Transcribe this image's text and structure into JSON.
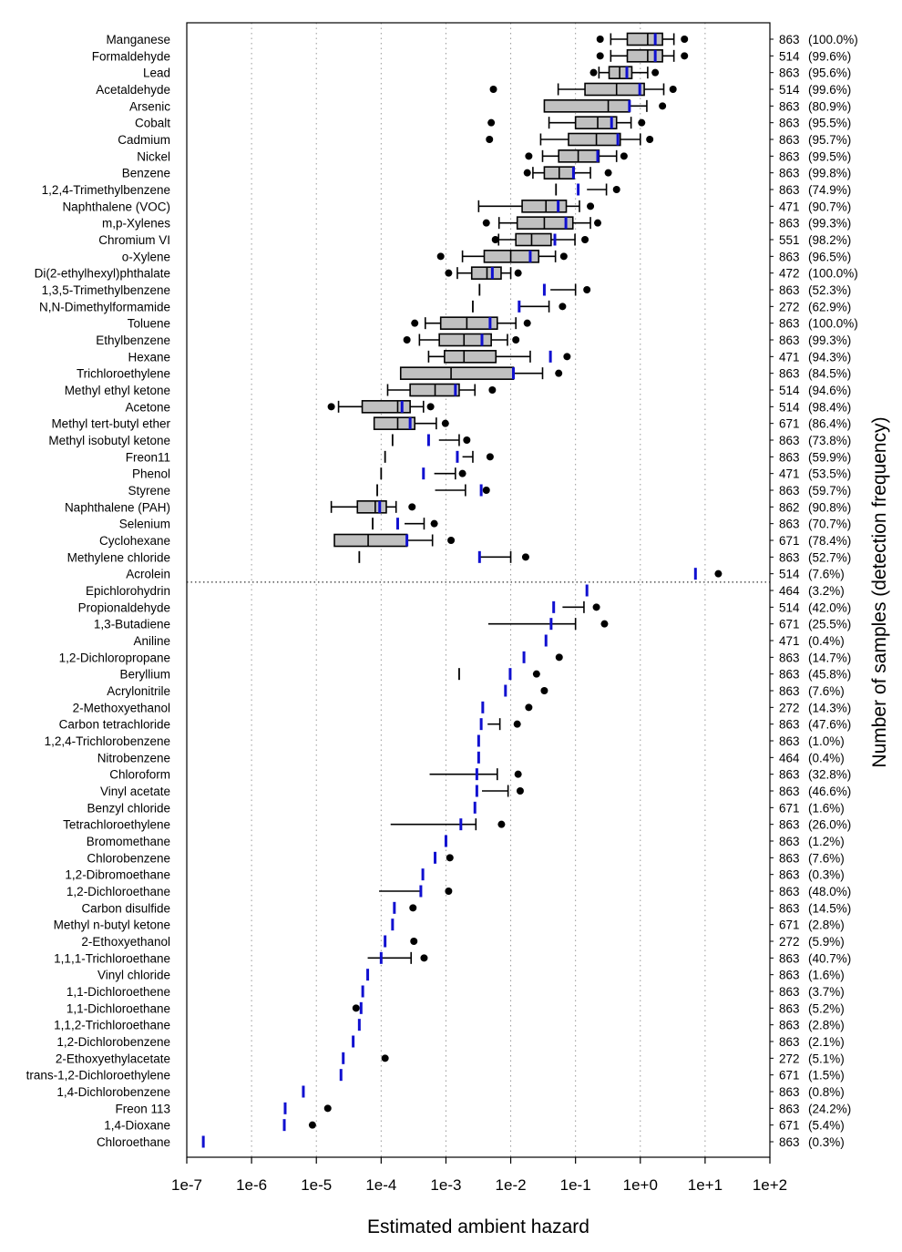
{
  "chart_data": {
    "type": "box",
    "xscale": "log",
    "xlim": [
      1e-07,
      100
    ],
    "xlabel": "Estimated ambient hazard",
    "ylabel_right": "Number of samples  (detection frequency)",
    "xticks": [
      "1e-7",
      "1e-6",
      "1e-5",
      "1e-4",
      "1e-3",
      "1e-2",
      "1e-1",
      "1e+0",
      "1e+1",
      "1e+2"
    ],
    "grid": "vertical dotted",
    "separator_after": "Acrolein",
    "colors": {
      "box": "#c0c0c0",
      "mean": "#1010d0",
      "outlier": "#000000",
      "grid": "#999999"
    },
    "rows": [
      {
        "name": "Manganese",
        "n": "863",
        "freq": "(100.0%)",
        "box": [
          0.35,
          0.63,
          1.3,
          2.2,
          3.3
        ],
        "mean": 1.7,
        "outliers": [
          0.24,
          4.8
        ]
      },
      {
        "name": "Formaldehyde",
        "n": "514",
        "freq": "(99.6%)",
        "box": [
          0.35,
          0.63,
          1.3,
          2.2,
          3.3
        ],
        "mean": 1.7,
        "outliers": [
          0.24,
          4.8
        ]
      },
      {
        "name": "Lead",
        "n": "863",
        "freq": "(95.6%)",
        "box": [
          0.23,
          0.33,
          0.48,
          0.74,
          1.3
        ],
        "mean": 0.62,
        "outliers": [
          0.19,
          1.7
        ]
      },
      {
        "name": "Acetaldehyde",
        "n": "514",
        "freq": "(99.6%)",
        "box": [
          0.054,
          0.14,
          0.43,
          1.15,
          2.3
        ],
        "mean": 0.98,
        "outliers": [
          0.0054,
          3.2
        ]
      },
      {
        "name": "Arsenic",
        "n": "863",
        "freq": "(80.9%)",
        "box": [
          0.033,
          0.033,
          0.32,
          0.68,
          1.26
        ],
        "mean": 0.68,
        "outliers": [
          2.2
        ]
      },
      {
        "name": "Cobalt",
        "n": "863",
        "freq": "(95.5%)",
        "box": [
          0.039,
          0.1,
          0.22,
          0.43,
          0.72
        ],
        "mean": 0.36,
        "outliers": [
          0.005,
          1.05
        ]
      },
      {
        "name": "Cadmium",
        "n": "863",
        "freq": "(95.7%)",
        "box": [
          0.029,
          0.078,
          0.21,
          0.49,
          1.0
        ],
        "mean": 0.45,
        "outliers": [
          0.0047,
          1.4
        ]
      },
      {
        "name": "Nickel",
        "n": "863",
        "freq": "(99.5%)",
        "box": [
          0.031,
          0.055,
          0.11,
          0.23,
          0.43
        ],
        "mean": 0.22,
        "outliers": [
          0.019,
          0.56
        ]
      },
      {
        "name": "Benzene",
        "n": "863",
        "freq": "(99.8%)",
        "box": [
          0.022,
          0.033,
          0.056,
          0.095,
          0.17
        ],
        "mean": 0.093,
        "outliers": [
          0.018,
          0.32
        ]
      },
      {
        "name": "1,2,4-Trimethylbenzene",
        "n": "863",
        "freq": "(74.9%)",
        "tick": 0.05,
        "mean": 0.11,
        "whisker": [
          0.15,
          0.3
        ],
        "outliers": [
          0.43
        ]
      },
      {
        "name": "Naphthalene (VOC)",
        "n": "471",
        "freq": "(90.7%)",
        "box": [
          0.0032,
          0.015,
          0.035,
          0.072,
          0.115
        ],
        "mean": 0.054,
        "outliers": [
          0.17
        ]
      },
      {
        "name": "m,p-Xylenes",
        "n": "863",
        "freq": "(99.3%)",
        "box": [
          0.0066,
          0.0126,
          0.033,
          0.091,
          0.17
        ],
        "mean": 0.071,
        "outliers": [
          0.0042,
          0.22
        ]
      },
      {
        "name": "Chromium VI",
        "n": "551",
        "freq": "(98.2%)",
        "box": [
          0.0065,
          0.012,
          0.021,
          0.042,
          0.098
        ],
        "mean": 0.048,
        "outliers": [
          0.0058,
          0.14
        ]
      },
      {
        "name": "o-Xylene",
        "n": "863",
        "freq": "(96.5%)",
        "box": [
          0.0018,
          0.0039,
          0.01,
          0.027,
          0.049
        ],
        "mean": 0.02,
        "outliers": [
          0.00083,
          0.066
        ]
      },
      {
        "name": "Di(2-ethylhexyl)phthalate",
        "n": "472",
        "freq": "(100.0%)",
        "box": [
          0.0015,
          0.0025,
          0.0043,
          0.0071,
          0.01
        ],
        "mean": 0.0052,
        "outliers": [
          0.0011,
          0.013
        ]
      },
      {
        "name": "1,3,5-Trimethylbenzene",
        "n": "863",
        "freq": "(52.3%)",
        "tick": 0.0033,
        "mean": 0.033,
        "whisker": [
          0.041,
          0.1
        ],
        "outliers": [
          0.15
        ]
      },
      {
        "name": "N,N-Dimethylformamide",
        "n": "272",
        "freq": "(62.9%)",
        "tick": 0.0026,
        "mean": 0.0135,
        "whisker": [
          0.0135,
          0.039
        ],
        "outliers": [
          0.063
        ]
      },
      {
        "name": "Toluene",
        "n": "863",
        "freq": "(100.0%)",
        "box": [
          0.00048,
          0.00083,
          0.0021,
          0.0062,
          0.012
        ],
        "mean": 0.0048,
        "outliers": [
          0.00033,
          0.018
        ]
      },
      {
        "name": "Ethylbenzene",
        "n": "863",
        "freq": "(99.3%)",
        "box": [
          0.00039,
          0.00079,
          0.0019,
          0.005,
          0.0089
        ],
        "mean": 0.0036,
        "outliers": [
          0.00025,
          0.012
        ]
      },
      {
        "name": "Hexane",
        "n": "471",
        "freq": "(94.3%)",
        "box": [
          0.00054,
          0.00095,
          0.0019,
          0.0059,
          0.02
        ],
        "mean": 0.041,
        "outliers": [
          0.074
        ]
      },
      {
        "name": "Trichloroethylene",
        "n": "863",
        "freq": "(84.5%)",
        "box": [
          0.0002,
          0.0002,
          0.0012,
          0.011,
          0.031
        ],
        "mean": 0.011,
        "outliers": [
          0.055
        ]
      },
      {
        "name": "Methyl ethyl ketone",
        "n": "514",
        "freq": "(94.6%)",
        "box": [
          0.000126,
          0.00028,
          0.00068,
          0.0016,
          0.0028
        ],
        "mean": 0.0014,
        "outliers": [
          0.0052
        ]
      },
      {
        "name": "Acetone",
        "n": "514",
        "freq": "(98.4%)",
        "box": [
          2.2e-05,
          5.1e-05,
          0.00018,
          0.00028,
          0.00045
        ],
        "mean": 0.00021,
        "outliers": [
          1.7e-05,
          0.00058
        ]
      },
      {
        "name": "Methyl tert-butyl ether",
        "n": "671",
        "freq": "(86.4%)",
        "box": [
          7.8e-05,
          7.8e-05,
          0.00018,
          0.00033,
          0.00071
        ],
        "mean": 0.00028,
        "outliers": [
          0.00098
        ]
      },
      {
        "name": "Methyl isobutyl ketone",
        "n": "863",
        "freq": "(73.8%)",
        "tick": 0.00015,
        "mean": 0.00054,
        "whisker": [
          0.00078,
          0.0016
        ],
        "outliers": [
          0.0021
        ]
      },
      {
        "name": "Freon11",
        "n": "863",
        "freq": "(59.9%)",
        "tick": 0.000115,
        "mean": 0.0015,
        "whisker": [
          0.0018,
          0.0026
        ],
        "outliers": [
          0.0048
        ]
      },
      {
        "name": "Phenol",
        "n": "471",
        "freq": "(53.5%)",
        "tick": 0.0001,
        "mean": 0.00045,
        "whisker": [
          0.00066,
          0.0014
        ],
        "outliers": [
          0.0018
        ]
      },
      {
        "name": "Styrene",
        "n": "863",
        "freq": "(59.7%)",
        "tick": 8.7e-05,
        "mean": 0.0035,
        "whisker": [
          0.00068,
          0.002
        ],
        "outliers": [
          0.0042
        ]
      },
      {
        "name": "Naphthalene (PAH)",
        "n": "862",
        "freq": "(90.8%)",
        "box": [
          1.7e-05,
          4.3e-05,
          8.1e-05,
          0.00012,
          0.00017
        ],
        "mean": 9.5e-05,
        "outliers": [
          0.0003
        ]
      },
      {
        "name": "Selenium",
        "n": "863",
        "freq": "(70.7%)",
        "tick": 7.4e-05,
        "mean": 0.00018,
        "whisker": [
          0.00023,
          0.00046
        ],
        "outliers": [
          0.00066
        ]
      },
      {
        "name": "Cyclohexane",
        "n": "671",
        "freq": "(78.4%)",
        "box": [
          1.9e-05,
          1.9e-05,
          6.3e-05,
          0.00025,
          0.00062
        ],
        "mean": 0.00025,
        "outliers": [
          0.0012
        ]
      },
      {
        "name": "Methylene chloride",
        "n": "863",
        "freq": "(52.7%)",
        "tick": 4.6e-05,
        "mean": 0.0033,
        "whisker": [
          0.0033,
          0.01
        ],
        "outliers": [
          0.017
        ]
      },
      {
        "name": "Acrolein",
        "n": "514",
        "freq": "(7.6%)",
        "mean": 7.1,
        "outliers": [
          16
        ]
      },
      {
        "name": "Epichlorohydrin",
        "n": "464",
        "freq": "(3.2%)",
        "mean": 0.15
      },
      {
        "name": "Propionaldehyde",
        "n": "514",
        "freq": "(42.0%)",
        "mean": 0.046,
        "whisker": [
          0.063,
          0.135
        ],
        "outliers": [
          0.21
        ]
      },
      {
        "name": "1,3-Butadiene",
        "n": "671",
        "freq": "(25.5%)",
        "mean": 0.042,
        "whisker": [
          0.0045,
          0.1
        ],
        "outliers": [
          0.28
        ]
      },
      {
        "name": "Aniline",
        "n": "471",
        "freq": "(0.4%)",
        "mean": 0.035
      },
      {
        "name": "1,2-Dichloropropane",
        "n": "863",
        "freq": "(14.7%)",
        "mean": 0.016,
        "outliers": [
          0.056
        ]
      },
      {
        "name": "Beryllium",
        "n": "863",
        "freq": "(45.8%)",
        "tick": 0.0016,
        "mean": 0.0098,
        "outliers": [
          0.025
        ]
      },
      {
        "name": "Acrylonitrile",
        "n": "863",
        "freq": "(7.6%)",
        "mean": 0.0083,
        "outliers": [
          0.033
        ]
      },
      {
        "name": "2-Methoxyethanol",
        "n": "272",
        "freq": "(14.3%)",
        "mean": 0.0037,
        "outliers": [
          0.019
        ]
      },
      {
        "name": "Carbon tetrachloride",
        "n": "863",
        "freq": "(47.6%)",
        "mean": 0.0035,
        "whisker": [
          0.0044,
          0.0068
        ],
        "outliers": [
          0.0126
        ]
      },
      {
        "name": "1,2,4-Trichlorobenzene",
        "n": "863",
        "freq": "(1.0%)",
        "mean": 0.0032
      },
      {
        "name": "Nitrobenzene",
        "n": "464",
        "freq": "(0.4%)",
        "mean": 0.0032
      },
      {
        "name": "Chloroform",
        "n": "863",
        "freq": "(32.8%)",
        "mean": 0.003,
        "whisker": [
          0.00056,
          0.0062
        ],
        "outliers": [
          0.013
        ]
      },
      {
        "name": "Vinyl acetate",
        "n": "863",
        "freq": "(46.6%)",
        "mean": 0.003,
        "whisker": [
          0.0036,
          0.0091
        ],
        "outliers": [
          0.014
        ]
      },
      {
        "name": "Benzyl chloride",
        "n": "671",
        "freq": "(1.6%)",
        "mean": 0.0028
      },
      {
        "name": "Tetrachloroethylene",
        "n": "863",
        "freq": "(26.0%)",
        "mean": 0.0017,
        "whisker": [
          0.00014,
          0.0029
        ],
        "outliers": [
          0.0072
        ]
      },
      {
        "name": "Bromomethane",
        "n": "863",
        "freq": "(1.2%)",
        "mean": 0.001
      },
      {
        "name": "Chlorobenzene",
        "n": "863",
        "freq": "(7.6%)",
        "mean": 0.00068,
        "outliers": [
          0.00115
        ]
      },
      {
        "name": "1,2-Dibromoethane",
        "n": "863",
        "freq": "(0.3%)",
        "mean": 0.00044
      },
      {
        "name": "1,2-Dichloroethane",
        "n": "863",
        "freq": "(48.0%)",
        "mean": 0.00041,
        "whisker": [
          9.3e-05,
          0.00041
        ],
        "outliers": [
          0.0011
        ]
      },
      {
        "name": "Carbon disulfide",
        "n": "863",
        "freq": "(14.5%)",
        "mean": 0.00016,
        "outliers": [
          0.00031
        ]
      },
      {
        "name": "Methyl n-butyl ketone",
        "n": "671",
        "freq": "(2.8%)",
        "mean": 0.00015
      },
      {
        "name": "2-Ethoxyethanol",
        "n": "272",
        "freq": "(5.9%)",
        "mean": 0.000115,
        "outliers": [
          0.00032
        ]
      },
      {
        "name": "1,1,1-Trichloroethane",
        "n": "863",
        "freq": "(40.7%)",
        "mean": 0.0001,
        "whisker": [
          6.2e-05,
          0.00029
        ],
        "outliers": [
          0.00046
        ]
      },
      {
        "name": "Vinyl chloride",
        "n": "863",
        "freq": "(1.6%)",
        "mean": 6.2e-05
      },
      {
        "name": "1,1-Dichloroethene",
        "n": "863",
        "freq": "(3.7%)",
        "mean": 5.2e-05
      },
      {
        "name": "1,1-Dichloroethane",
        "n": "863",
        "freq": "(5.2%)",
        "mean": 4.9e-05,
        "outliers": [
          4.1e-05
        ]
      },
      {
        "name": "1,1,2-Trichloroethane",
        "n": "863",
        "freq": "(2.8%)",
        "mean": 4.6e-05
      },
      {
        "name": "1,2-Dichlorobenzene",
        "n": "863",
        "freq": "(2.1%)",
        "mean": 3.7e-05
      },
      {
        "name": "2-Ethoxyethylacetate",
        "n": "272",
        "freq": "(5.1%)",
        "mean": 2.6e-05,
        "outliers": [
          0.000115
        ]
      },
      {
        "name": "trans-1,2-Dichloroethylene",
        "n": "671",
        "freq": "(1.5%)",
        "mean": 2.4e-05
      },
      {
        "name": "1,4-Dichlorobenzene",
        "n": "863",
        "freq": "(0.8%)",
        "mean": 6.3e-06
      },
      {
        "name": "Freon 113",
        "n": "863",
        "freq": "(24.2%)",
        "mean": 3.3e-06,
        "outliers": [
          1.5e-05
        ]
      },
      {
        "name": "1,4-Dioxane",
        "n": "671",
        "freq": "(5.4%)",
        "mean": 3.2e-06,
        "outliers": [
          8.7e-06
        ]
      },
      {
        "name": "Chloroethane",
        "n": "863",
        "freq": "(0.3%)",
        "mean": 1.8e-07
      }
    ]
  }
}
